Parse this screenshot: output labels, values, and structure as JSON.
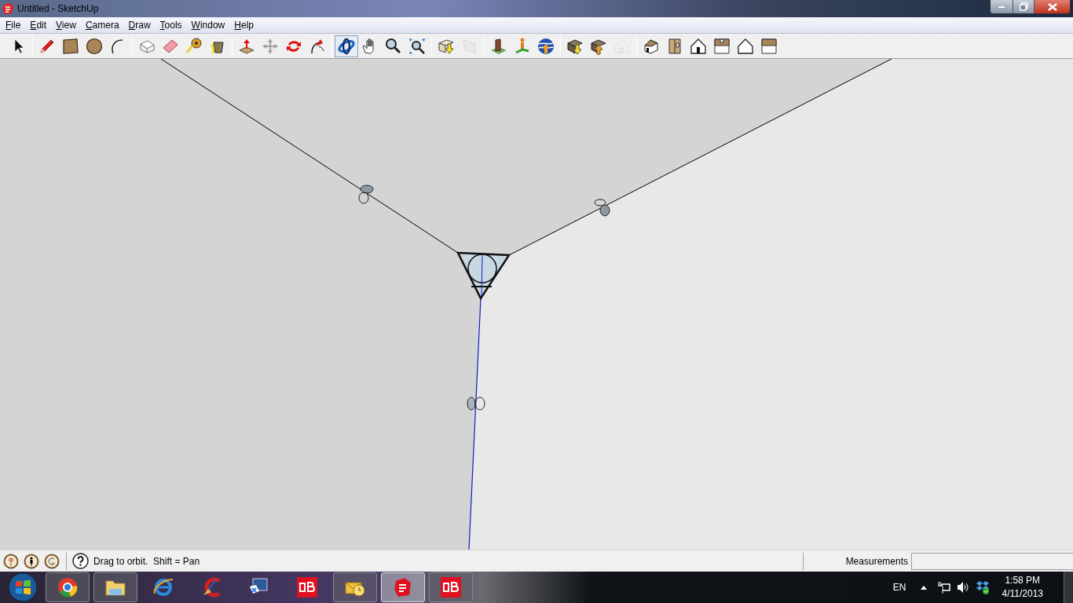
{
  "window": {
    "title": "Untitled - SketchUp"
  },
  "menu": [
    {
      "label": "File"
    },
    {
      "label": "Edit"
    },
    {
      "label": "View"
    },
    {
      "label": "Camera"
    },
    {
      "label": "Draw"
    },
    {
      "label": "Tools"
    },
    {
      "label": "Window"
    },
    {
      "label": "Help"
    }
  ],
  "toolbar": {
    "groups": [
      [
        {
          "selected": false,
          "disabled": false
        }
      ],
      [
        {
          "selected": false,
          "disabled": false
        },
        {
          "selected": false,
          "disabled": false
        },
        {
          "selected": false,
          "disabled": false
        },
        {
          "selected": false,
          "disabled": false
        }
      ],
      [
        {
          "selected": false,
          "disabled": false
        },
        {
          "selected": false,
          "disabled": false
        },
        {
          "selected": false,
          "disabled": false
        },
        {
          "selected": false,
          "disabled": false
        }
      ],
      [
        {
          "selected": false,
          "disabled": false
        },
        {
          "selected": false,
          "disabled": false
        },
        {
          "selected": false,
          "disabled": false
        },
        {
          "selected": false,
          "disabled": false
        }
      ],
      [
        {
          "selected": true,
          "disabled": false
        },
        {
          "selected": false,
          "disabled": false
        },
        {
          "selected": false,
          "disabled": false
        },
        {
          "selected": false,
          "disabled": false
        }
      ],
      [
        {
          "selected": false,
          "disabled": false
        },
        {
          "selected": false,
          "disabled": true
        }
      ],
      [
        {
          "selected": false,
          "disabled": false
        },
        {
          "selected": false,
          "disabled": false
        },
        {
          "selected": false,
          "disabled": false
        }
      ],
      [
        {
          "selected": false,
          "disabled": false
        },
        {
          "selected": false,
          "disabled": false
        },
        {
          "selected": false,
          "disabled": true
        }
      ],
      [
        {
          "selected": false,
          "disabled": false
        },
        {
          "selected": false,
          "disabled": false
        },
        {
          "selected": false,
          "disabled": false
        },
        {
          "selected": false,
          "disabled": false
        },
        {
          "selected": false,
          "disabled": false
        },
        {
          "selected": false,
          "disabled": false
        }
      ]
    ]
  },
  "status_bar": {
    "hint": "Drag to orbit.  Shift = Pan",
    "measurements_label": "Measurements"
  },
  "taskbar": {
    "apps": [
      {
        "running": true,
        "selected": false
      },
      {
        "running": true,
        "selected": false
      },
      {
        "running": false,
        "selected": false
      },
      {
        "running": false,
        "selected": false
      },
      {
        "running": false,
        "selected": false
      },
      {
        "running": false,
        "selected": false
      },
      {
        "running": true,
        "selected": false
      },
      {
        "running": true,
        "selected": true
      },
      {
        "running": true,
        "selected": false
      }
    ],
    "tray": {
      "language": "EN",
      "time": "1:58 PM",
      "date": "4/11/2013"
    }
  }
}
